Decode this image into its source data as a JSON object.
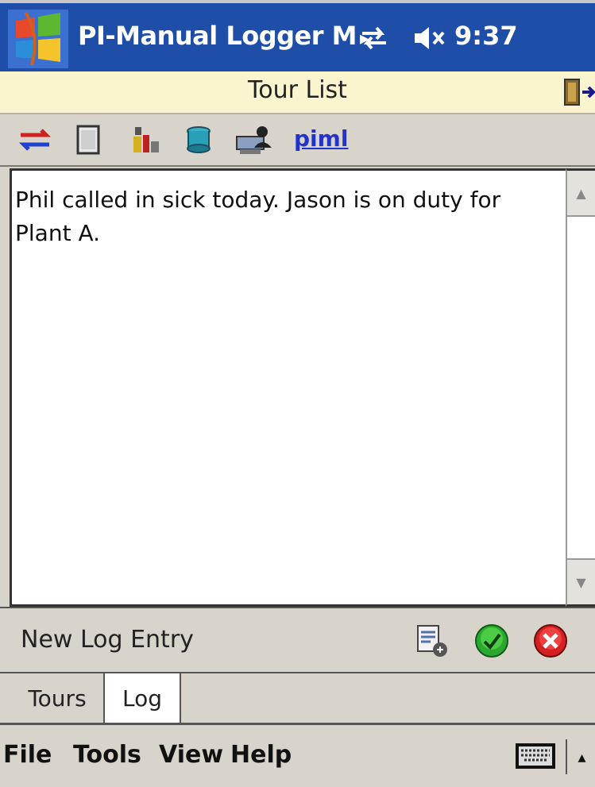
{
  "titlebar": {
    "app_title": "PI-Manual Logger M",
    "chevron": "▸",
    "clock": "9:37",
    "start_icon": "windows-flag-icon",
    "sync_icon": "sync-arrows-icon",
    "volume_icon": "speaker-muted-icon",
    "bg_color": "#1f4ea8"
  },
  "header": {
    "title": "Tour List",
    "exit_icon": "exit-door-icon",
    "bg_color": "#fbf5cf"
  },
  "toolbar": {
    "items": [
      {
        "name": "transfer-icon"
      },
      {
        "name": "document-icon"
      },
      {
        "name": "tools-icon"
      },
      {
        "name": "database-icon"
      },
      {
        "name": "user-computer-icon"
      }
    ],
    "link_label": "piml"
  },
  "log_text": "Phil called in sick today. Jason is on duty for Plant A.",
  "log_entry": {
    "label": "New Log Entry",
    "icons": [
      "edit-entry-icon",
      "ok-check-icon",
      "cancel-x-icon"
    ]
  },
  "tabs": [
    {
      "label": "Tours",
      "active": false
    },
    {
      "label": "Log",
      "active": true
    }
  ],
  "menu": {
    "items": [
      "File",
      "Tools",
      "View",
      "Help"
    ],
    "keyboard_icon": "keyboard-icon",
    "sip_arrow": "▴"
  }
}
